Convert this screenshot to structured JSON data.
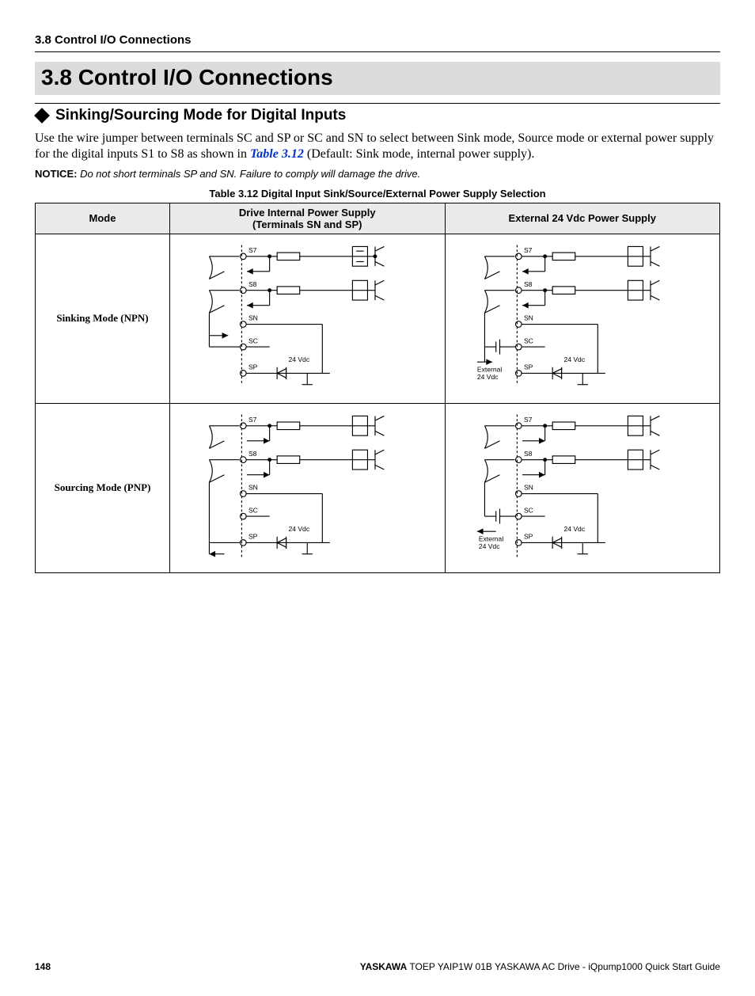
{
  "header": {
    "running": "3.8 Control I/O Connections",
    "section_title": "3.8   Control I/O Connections"
  },
  "subheading": {
    "title": "Sinking/Sourcing Mode for Digital Inputs"
  },
  "paragraph": {
    "p1a": "Use the wire jumper between terminals SC and SP or SC and SN to select between Sink mode, Source mode or external power supply for the digital inputs S1 to S8 as shown in ",
    "link": "Table 3.12",
    "p1b": " (Default: Sink mode, internal power supply)."
  },
  "notice": {
    "label": "NOTICE:",
    "msg": " Do not short terminals SP and SN. Failure to comply will damage the drive."
  },
  "table": {
    "caption": "Table 3.12  Digital Input Sink/Source/External Power Supply Selection",
    "headers": {
      "mode": "Mode",
      "internal_line1": "Drive Internal Power Supply",
      "internal_line2": "(Terminals SN and SP)",
      "external": "External 24 Vdc Power Supply"
    },
    "rows": [
      {
        "mode": "Sinking Mode (NPN)"
      },
      {
        "mode": "Sourcing Mode (PNP)"
      }
    ],
    "diagram_labels": {
      "s7": "S7",
      "s8": "S8",
      "sn": "SN",
      "sc": "SC",
      "sp": "SP",
      "v24": "24 Vdc",
      "ext1": "External",
      "ext2": "24 Vdc"
    }
  },
  "footer": {
    "page": "148",
    "brand": "YASKAWA",
    "rest": " TOEP YAIP1W 01B YASKAWA AC Drive - iQpump1000 Quick Start Guide"
  }
}
